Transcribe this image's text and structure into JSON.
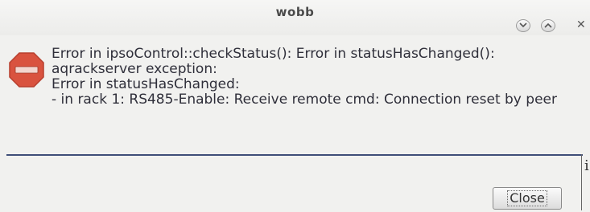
{
  "window": {
    "title": "wobb"
  },
  "titlebar_buttons": {
    "close_glyph": "✕",
    "icons": [
      "chevron-down-icon",
      "chevron-up-icon",
      "close-icon"
    ]
  },
  "dialog": {
    "icon": "stop-sign-icon",
    "icon_color": "#d9533f",
    "message_lines": [
      "Error in ipsoControl::checkStatus(): Error in statusHasChanged():",
      "aqrackserver exception:",
      "Error in statusHasChanged:",
      "- in rack 1: RS485-Enable: Receive remote cmd: Connection reset by peer"
    ],
    "side_glyph": "i",
    "close_button_label": "Close"
  },
  "colors": {
    "divider": "#3f4e78",
    "text": "#2f2f3a"
  }
}
